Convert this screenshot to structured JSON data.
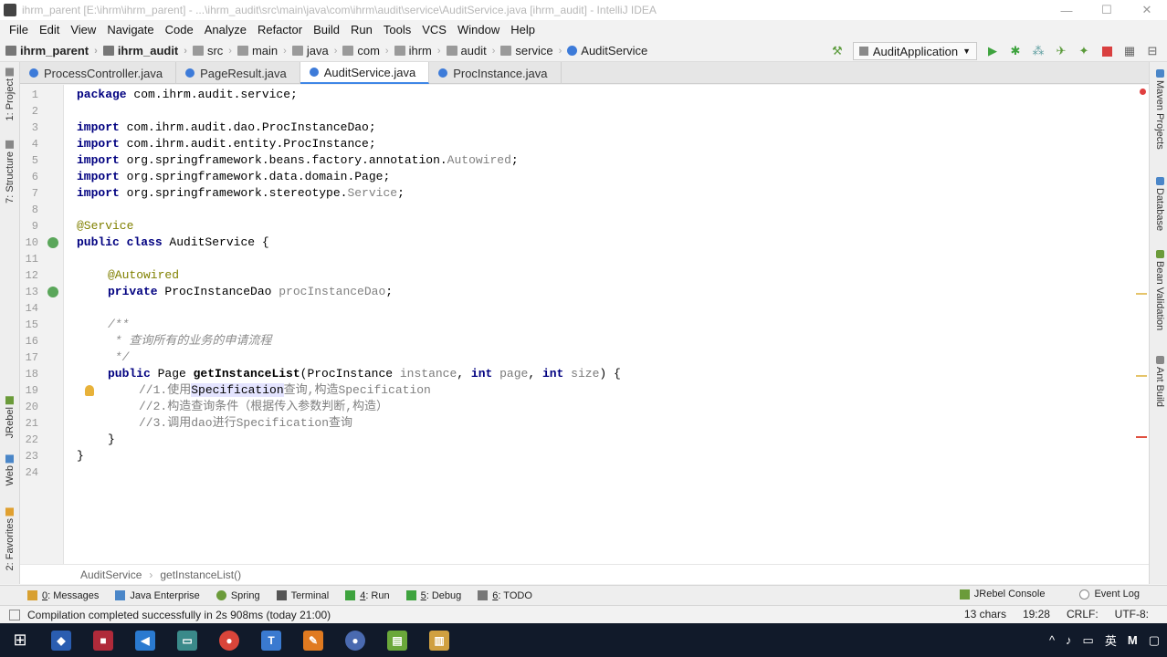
{
  "window": {
    "title": "ihrm_parent [E:\\ihrm\\ihrm_parent] - ...\\ihrm_audit\\src\\main\\java\\com\\ihrm\\audit\\service\\AuditService.java [ihrm_audit] - IntelliJ IDEA",
    "minimize": "—",
    "maximize": "☐",
    "close": "✕"
  },
  "menu": [
    "File",
    "Edit",
    "View",
    "Navigate",
    "Code",
    "Analyze",
    "Refactor",
    "Build",
    "Run",
    "Tools",
    "VCS",
    "Window",
    "Help"
  ],
  "breadcrumb": [
    "ihrm_parent",
    "ihrm_audit",
    "src",
    "main",
    "java",
    "com",
    "ihrm",
    "audit",
    "service",
    "AuditService"
  ],
  "run_config": "AuditApplication",
  "tabs": [
    {
      "label": "ProcessController.java"
    },
    {
      "label": "PageResult.java"
    },
    {
      "label": "AuditService.java"
    },
    {
      "label": "ProcInstance.java"
    }
  ],
  "left_tools": [
    "1: Project",
    "7: Structure",
    "JRebel",
    "Web",
    "2: Favorites"
  ],
  "right_tools": [
    "Maven Projects",
    "Database",
    "Bean Validation",
    "Ant Build"
  ],
  "line_numbers": [
    "1",
    "2",
    "3",
    "4",
    "5",
    "6",
    "7",
    "8",
    "9",
    "10",
    "11",
    "12",
    "13",
    "14",
    "15",
    "16",
    "17",
    "18",
    "19",
    "20",
    "21",
    "22",
    "23",
    "24"
  ],
  "code": {
    "l1_kw": "package",
    "l1_rest": " com.ihrm.audit.service;",
    "l3_kw": "import",
    "l3_rest": " com.ihrm.audit.dao.ProcInstanceDao;",
    "l4_kw": "import",
    "l4_rest": " com.ihrm.audit.entity.ProcInstance;",
    "l5_kw": "import",
    "l5_rest": " org.springframework.beans.factory.annotation.",
    "l5_dim": "Autowired",
    "l5_end": ";",
    "l6_kw": "import",
    "l6_rest": " org.springframework.data.domain.Page;",
    "l7_kw": "import",
    "l7_rest": " org.springframework.stereotype.",
    "l7_dim": "Service",
    "l7_end": ";",
    "l9": "@Service",
    "l10_kw": "public class",
    "l10_rest": " AuditService {",
    "l12": "@Autowired",
    "l13_kw": "private",
    "l13_type": " ProcInstanceDao ",
    "l13_field": "procInstanceDao",
    "l13_end": ";",
    "l15": "/**",
    "l16": " * 查询所有的业务的申请流程",
    "l17": " */",
    "l18_kw1": "public",
    "l18_type": " Page ",
    "l18_name": "getInstanceList",
    "l18_p1": "(ProcInstance ",
    "l18_a1": "instance",
    "l18_c1": ", ",
    "l18_kw2": "int",
    "l18_sp": " ",
    "l18_a2": "page",
    "l18_c2": ", ",
    "l18_kw3": "int",
    "l18_sp2": " ",
    "l18_a3": "size",
    "l18_end": ") {",
    "l19_a": "//1.使用",
    "l19_hl": "Specification",
    "l19_b": "查询,构造Specification",
    "l20": "//2.构造查询条件（根据传入参数判断,构造）",
    "l21": "//3.调用dao进行Specification查询",
    "l22": "}",
    "l23": "}"
  },
  "editor_breadcrumb": [
    "AuditService",
    "getInstanceList()"
  ],
  "bottom_tools": [
    {
      "num": "0",
      "label": ": Messages"
    },
    {
      "num": "",
      "label": "Java Enterprise"
    },
    {
      "num": "",
      "label": "Spring"
    },
    {
      "num": "",
      "label": "Terminal"
    },
    {
      "num": "4",
      "label": ": Run"
    },
    {
      "num": "5",
      "label": ": Debug"
    },
    {
      "num": "6",
      "label": ": TODO"
    }
  ],
  "bottom_right_tools": [
    "JRebel Console",
    "Event Log"
  ],
  "status": {
    "message": "Compilation completed successfully in 2s 908ms (today 21:00)",
    "chars": "13 chars",
    "position": "19:28",
    "line_sep": "CRLF:",
    "encoding": "UTF-8:"
  },
  "taskbar": {
    "tray_lang": "英",
    "tray_m": "M"
  }
}
